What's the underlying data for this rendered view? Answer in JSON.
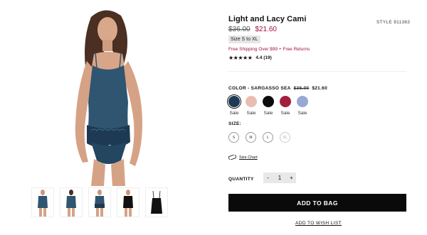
{
  "product": {
    "title": "Light and Lacy Cami",
    "style": "STYLE 811363",
    "price_old": "$36.00",
    "price_new": "$21.60",
    "size_range": "Size S to XL",
    "shipping": "Free Shipping Over $99 + Free Returns",
    "rating_stars": "★★★★★",
    "rating": "4.4 (19)",
    "rating_value": 4.4
  },
  "color": {
    "label": "COLOR - SARGASSO SEA",
    "price_old": "$36.00",
    "price_new": "$21.60",
    "swatches": [
      {
        "hex": "#1e3a56",
        "label": "Sale",
        "selected": true
      },
      {
        "hex": "#e9bdb2",
        "label": "Sale",
        "selected": false
      },
      {
        "hex": "#0c0c0c",
        "label": "Sale",
        "selected": false
      },
      {
        "hex": "#a3203d",
        "label": "Sale",
        "selected": false
      },
      {
        "hex": "#97a8d4",
        "label": "Sale",
        "selected": false
      }
    ]
  },
  "size": {
    "label": "SIZE:",
    "options": [
      "S",
      "M",
      "L",
      "XL"
    ],
    "chart_link": "Size Chart"
  },
  "quantity": {
    "label": "QUANTITY",
    "minus": "-",
    "value": "1",
    "plus": "+"
  },
  "actions": {
    "add_to_bag": "ADD TO BAG",
    "wish_list": "ADD TO WISH LIST"
  },
  "colors": {
    "product_teal": "#2f5570",
    "sale_red": "#a0123a"
  }
}
